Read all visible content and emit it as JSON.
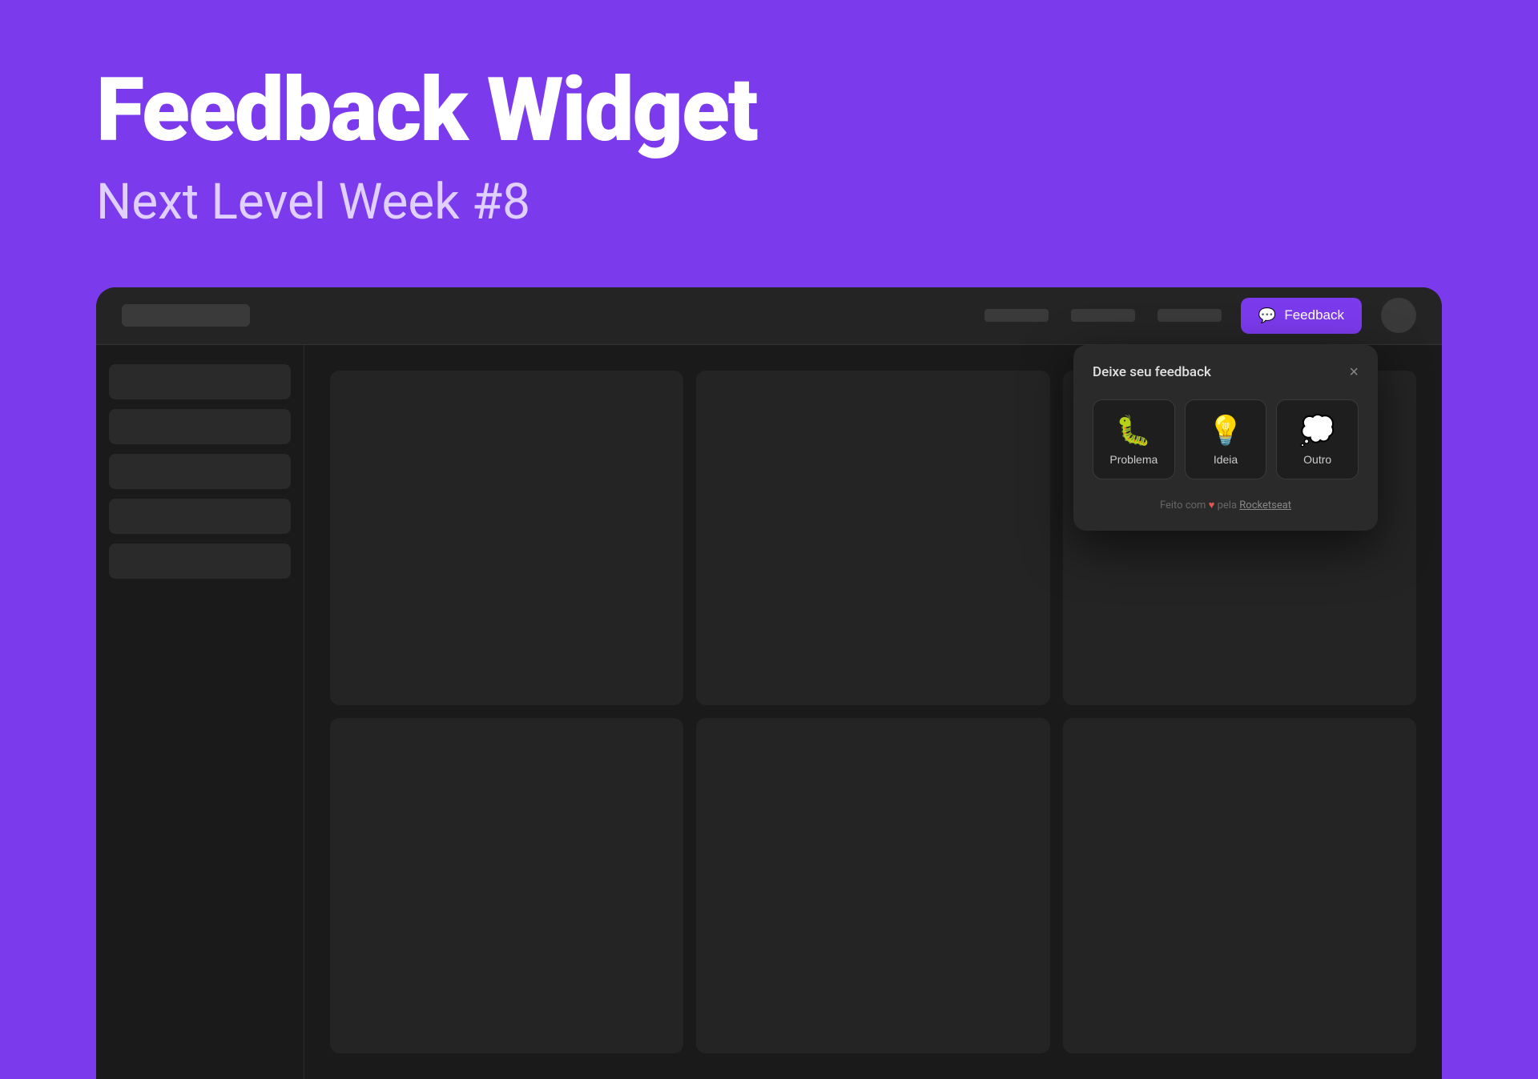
{
  "hero": {
    "title": "Feedback Widget",
    "subtitle": "Next Level Week #8"
  },
  "nav": {
    "feedback_button_label": "Feedback",
    "feedback_icon": "💬"
  },
  "widget": {
    "popup_title": "Deixe seu feedback",
    "close_label": "×",
    "options": [
      {
        "id": "problema",
        "emoji": "🐛",
        "label": "Problema"
      },
      {
        "id": "ideia",
        "emoji": "💡",
        "label": "Ideia"
      },
      {
        "id": "outro",
        "emoji": "💭",
        "label": "Outro"
      }
    ],
    "footer_text_pre": "Feito com ",
    "footer_heart": "♥",
    "footer_text_mid": " pela ",
    "footer_brand": "Rocketseat"
  }
}
